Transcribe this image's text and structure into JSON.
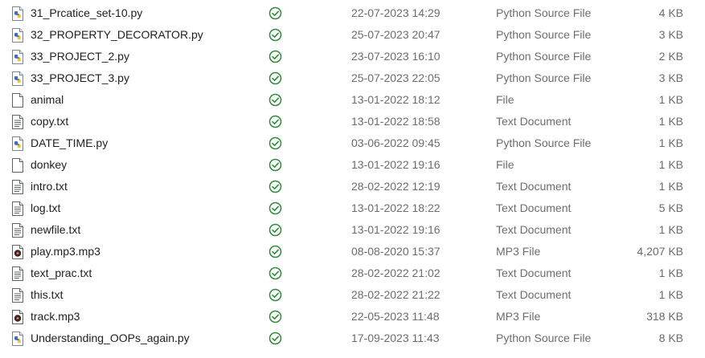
{
  "files": [
    {
      "name": "31_Prcatice_set-10.py",
      "date": "22-07-2023 14:29",
      "type": "Python Source File",
      "size": "4 KB",
      "icon": "python-file-icon"
    },
    {
      "name": "32_PROPERTY_DECORATOR.py",
      "date": "25-07-2023 20:47",
      "type": "Python Source File",
      "size": "3 KB",
      "icon": "python-file-icon"
    },
    {
      "name": "33_PROJECT_2.py",
      "date": "23-07-2023 16:10",
      "type": "Python Source File",
      "size": "2 KB",
      "icon": "python-file-icon"
    },
    {
      "name": "33_PROJECT_3.py",
      "date": "25-07-2023 22:05",
      "type": "Python Source File",
      "size": "3 KB",
      "icon": "python-file-icon"
    },
    {
      "name": "animal",
      "date": "13-01-2022 18:12",
      "type": "File",
      "size": "1 KB",
      "icon": "blank-file-icon"
    },
    {
      "name": "copy.txt",
      "date": "13-01-2022 18:58",
      "type": "Text Document",
      "size": "1 KB",
      "icon": "text-file-icon"
    },
    {
      "name": "DATE_TIME.py",
      "date": "03-06-2022 09:45",
      "type": "Python Source File",
      "size": "1 KB",
      "icon": "python-file-icon"
    },
    {
      "name": "donkey",
      "date": "13-01-2022 19:16",
      "type": "File",
      "size": "1 KB",
      "icon": "blank-file-icon"
    },
    {
      "name": "intro.txt",
      "date": "28-02-2022 12:19",
      "type": "Text Document",
      "size": "1 KB",
      "icon": "text-file-icon"
    },
    {
      "name": "log.txt",
      "date": "13-01-2022 18:22",
      "type": "Text Document",
      "size": "5 KB",
      "icon": "text-file-icon"
    },
    {
      "name": "newfile.txt",
      "date": "13-01-2022 19:16",
      "type": "Text Document",
      "size": "1 KB",
      "icon": "text-file-icon"
    },
    {
      "name": "play.mp3.mp3",
      "date": "08-08-2020 15:37",
      "type": "MP3 File",
      "size": "4,207 KB",
      "icon": "audio-file-icon"
    },
    {
      "name": "text_prac.txt",
      "date": "28-02-2022 21:02",
      "type": "Text Document",
      "size": "1 KB",
      "icon": "text-file-icon"
    },
    {
      "name": "this.txt",
      "date": "28-02-2022 21:22",
      "type": "Text Document",
      "size": "1 KB",
      "icon": "text-file-icon"
    },
    {
      "name": "track.mp3",
      "date": "22-05-2023 11:48",
      "type": "MP3 File",
      "size": "318 KB",
      "icon": "audio-file-icon"
    },
    {
      "name": "Understanding_OOPs_again.py",
      "date": "17-09-2023 11:43",
      "type": "Python Source File",
      "size": "8 KB",
      "icon": "python-file-icon"
    }
  ],
  "status_icon": "synced-check-icon",
  "colors": {
    "sync_green": "#2e8b3a",
    "python_blue": "#3b6fb6",
    "python_yellow": "#f2c43b",
    "secondary_text": "#6d6d6d"
  }
}
